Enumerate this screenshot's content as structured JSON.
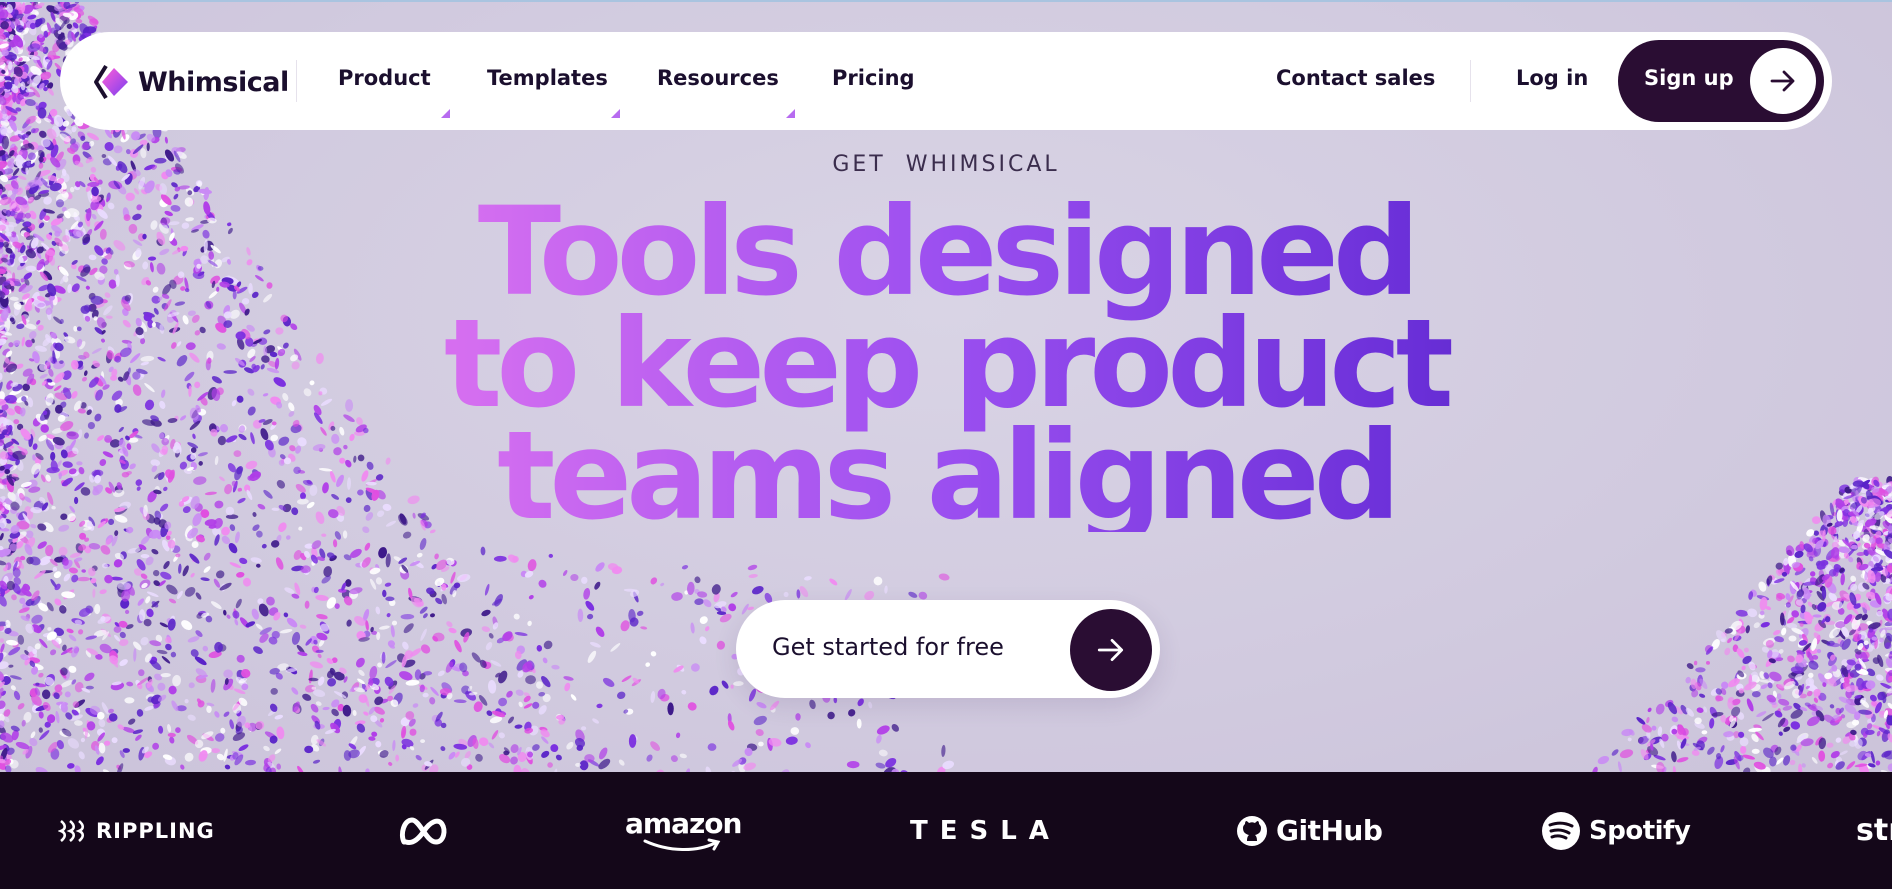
{
  "nav": {
    "logo_text": "Whimsical",
    "items": [
      {
        "label": "Product",
        "has_dropdown": true
      },
      {
        "label": "Templates",
        "has_dropdown": true
      },
      {
        "label": "Resources",
        "has_dropdown": true
      },
      {
        "label": "Pricing",
        "has_dropdown": false
      }
    ],
    "contact_sales": "Contact sales",
    "login": "Log in",
    "signup": "Sign up"
  },
  "hero": {
    "eyebrow": "GET  WHIMSICAL",
    "headline_lines": [
      "Tools designed",
      "to keep product",
      "teams aligned"
    ],
    "cta_label": "Get started for free"
  },
  "logos": [
    {
      "name": "RIPPLING",
      "icon": "rippling-icon"
    },
    {
      "name": "",
      "icon": "meta-icon"
    },
    {
      "name": "amazon",
      "icon": "amazon-smile-icon"
    },
    {
      "name": "TESLA",
      "icon": "tesla-wordmark"
    },
    {
      "name": "GitHub",
      "icon": "github-icon"
    },
    {
      "name": "Spotify",
      "icon": "spotify-icon"
    },
    {
      "name": "str",
      "icon": "partial-logo"
    }
  ],
  "colors": {
    "accent_dark": "#2a0d33",
    "background": "#d3cde0",
    "strip": "#140719",
    "gradient_start": "#ff6ae6",
    "gradient_end": "#36148f"
  }
}
